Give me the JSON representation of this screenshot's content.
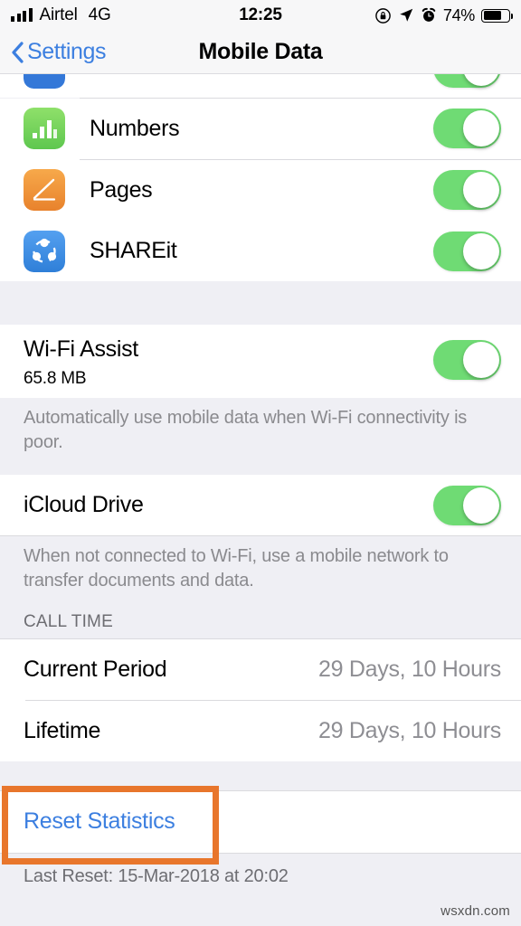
{
  "status_bar": {
    "carrier": "Airtel",
    "network_type": "4G",
    "time": "12:25",
    "battery_percent": "74%",
    "battery_level": 74,
    "icons": [
      "signal-bars-icon",
      "rotation-lock-icon",
      "location-arrow-icon",
      "alarm-clock-icon",
      "battery-icon"
    ]
  },
  "nav": {
    "back_label": "Settings",
    "title": "Mobile Data",
    "accent_color": "#3c7fe0"
  },
  "apps_section": {
    "rows": [
      {
        "label": "Numbers",
        "icon": "numbers-app-icon",
        "toggle": "on"
      },
      {
        "label": "Pages",
        "icon": "pages-app-icon",
        "toggle": "on"
      },
      {
        "label": "SHAREit",
        "icon": "shareit-app-icon",
        "toggle": "on"
      }
    ]
  },
  "wifi_assist": {
    "label": "Wi-Fi Assist",
    "usage": "65.8 MB",
    "toggle": "on",
    "footer": "Automatically use mobile data when Wi-Fi connectivity is poor."
  },
  "icloud_drive": {
    "label": "iCloud Drive",
    "toggle": "on",
    "footer": "When not connected to Wi-Fi, use a mobile network to transfer documents and data."
  },
  "call_time": {
    "header": "CALL TIME",
    "rows": [
      {
        "label": "Current Period",
        "value": "29 Days, 10 Hours"
      },
      {
        "label": "Lifetime",
        "value": "29 Days, 10 Hours"
      }
    ]
  },
  "reset": {
    "label": "Reset Statistics",
    "last_reset": "Last Reset: 15-Mar-2018 at 20:02",
    "highlight_color": "#e8762c"
  },
  "watermark": "wsxdn.com",
  "colors": {
    "toggle_on": "#6fdb74",
    "group_background": "#efeff4",
    "row_background": "#ffffff",
    "link_blue": "#3c7fe0",
    "secondary_text": "#8e8e93"
  }
}
